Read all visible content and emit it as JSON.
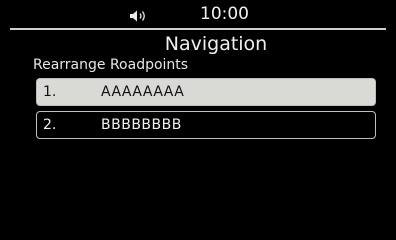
{
  "status_bar": {
    "volume_icon": "speaker-volume-icon",
    "time": "10:00"
  },
  "header": {
    "title": "Navigation",
    "subtitle": "Rearrange Roadpoints"
  },
  "roadpoints": [
    {
      "index": "1.",
      "label": "AAAAAAAA",
      "selected": true
    },
    {
      "index": "2.",
      "label": "BBBBBBBB",
      "selected": false
    }
  ],
  "colors": {
    "background": "#000000",
    "selected_item": "#d9d9d6",
    "text": "#ffffff"
  }
}
